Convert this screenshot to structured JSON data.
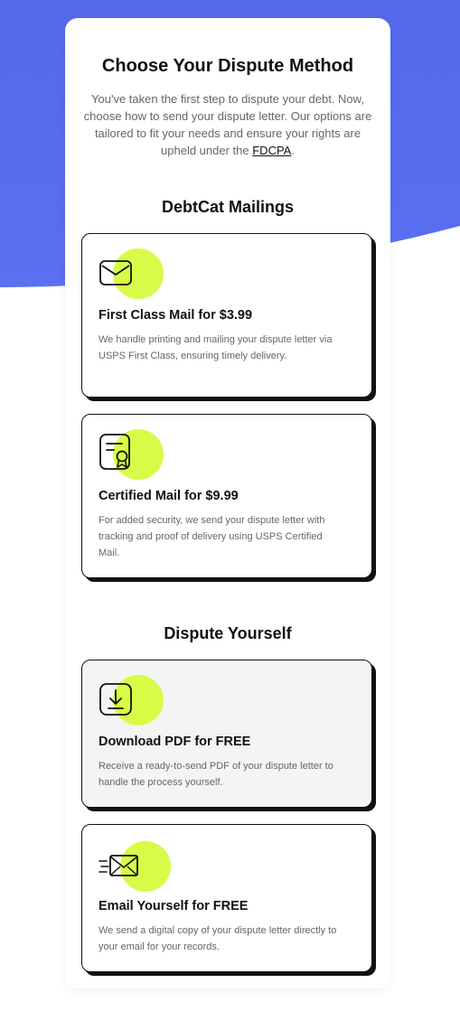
{
  "header": {
    "title": "Choose Your Dispute Method",
    "intro_text": "You've taken the first step to dispute your debt. Now, choose how to send your dispute letter. Our options are tailored to fit your needs and ensure your rights are upheld under the ",
    "intro_link": "FDCPA",
    "intro_end": "."
  },
  "sections": [
    {
      "title": "DebtCat Mailings",
      "options": [
        {
          "icon": "envelope-icon",
          "title": "First Class Mail for $3.99",
          "description": "We handle printing and mailing your dispute letter via USPS First Class, ensuring timely delivery."
        },
        {
          "icon": "certificate-icon",
          "title": "Certified Mail for $9.99",
          "description": "For added security, we send your dispute letter with tracking and proof of delivery using USPS Certified Mail."
        }
      ]
    },
    {
      "title": "Dispute Yourself",
      "options": [
        {
          "icon": "download-icon",
          "title": "Download PDF for FREE",
          "description": "Receive a ready-to-send PDF of your dispute letter to handle the process yourself.",
          "selected": true
        },
        {
          "icon": "send-email-icon",
          "title": "Email Yourself for FREE",
          "description": "We send a digital copy of your dispute letter directly to your email for your records."
        }
      ]
    }
  ],
  "colors": {
    "background_blue": "#5469e9",
    "accent_lime": "#d8fb47",
    "card_border": "#111111",
    "selected_card_bg": "#f4f4f4"
  }
}
